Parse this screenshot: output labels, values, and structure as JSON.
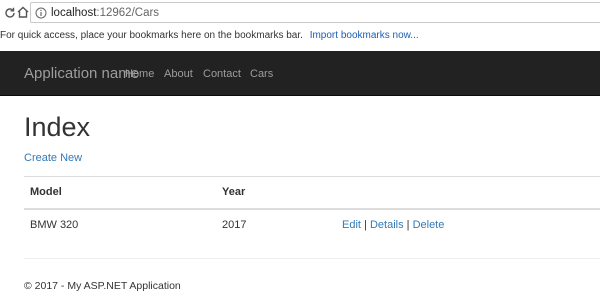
{
  "browser": {
    "url_host": "localhost",
    "url_path": ":12962/Cars",
    "bookmarks_text": "For quick access, place your bookmarks here on the bookmarks bar.",
    "bookmarks_link": "Import bookmarks now..."
  },
  "navbar": {
    "brand": "Application name",
    "links": [
      "Home",
      "About",
      "Contact",
      "Cars"
    ]
  },
  "main": {
    "title": "Index",
    "create_link": "Create New",
    "table": {
      "columns": [
        "Model",
        "Year"
      ],
      "rows": [
        {
          "model": "BMW 320",
          "year": "2017",
          "actions": {
            "edit": "Edit",
            "details": "Details",
            "delete": "Delete",
            "separator": "|"
          }
        }
      ]
    }
  },
  "footer": {
    "text": "© 2017 - My ASP.NET Application"
  },
  "colors": {
    "navbar_bg": "#222222",
    "link": "#337ab7",
    "nav_text": "#9d9d9d"
  },
  "icons": [
    "back-arrow-icon",
    "forward-arrow-icon",
    "reload-icon",
    "home-icon",
    "info-icon"
  ]
}
